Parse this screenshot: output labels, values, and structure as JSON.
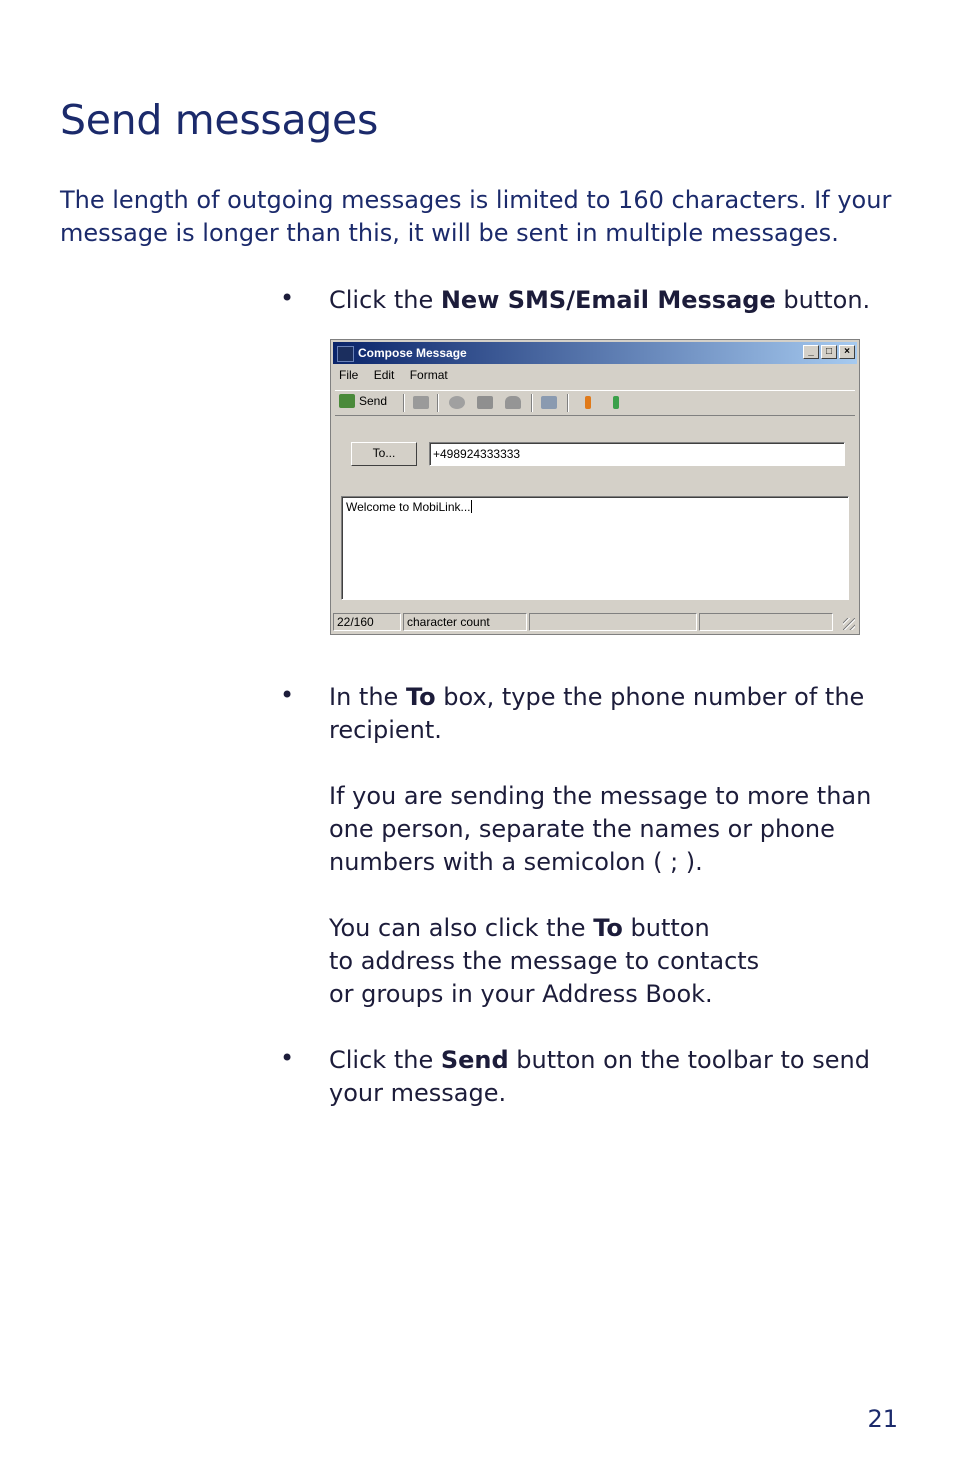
{
  "title": "Send messages",
  "intro": "The length of outgoing messages is limited to 160 characters. If your message is longer than this, it will be sent in multiple messages.",
  "bullet_glyph": "•",
  "step1": {
    "pre": "Click the ",
    "bold": "New SMS/Email Message",
    "post": " button."
  },
  "window": {
    "title": "Compose Message",
    "min_glyph": "_",
    "max_glyph": "□",
    "close_glyph": "×",
    "menu": [
      "File",
      "Edit",
      "Format"
    ],
    "send_label": "Send",
    "to_button": "To...",
    "to_value": "+498924333333",
    "message": "Welcome to MobiLink...",
    "status_count": "22/160",
    "status_label": "character count"
  },
  "step2": {
    "pre": "In the ",
    "bold": "To",
    "post": " box, type the phone number of the recipient."
  },
  "step2_p2": "If you are sending the message to more than one person, separate the names or phone numbers with a semicolon ( ; ).",
  "step2_p3": {
    "pre": "You can also click the ",
    "bold": "To",
    "post1": " button",
    "line2": "to address the message to contacts",
    "line3": "or groups in your Address Book."
  },
  "step3": {
    "pre": "Click the ",
    "bold": "Send",
    "post": " button on the toolbar to send your message."
  },
  "page_number": "21"
}
